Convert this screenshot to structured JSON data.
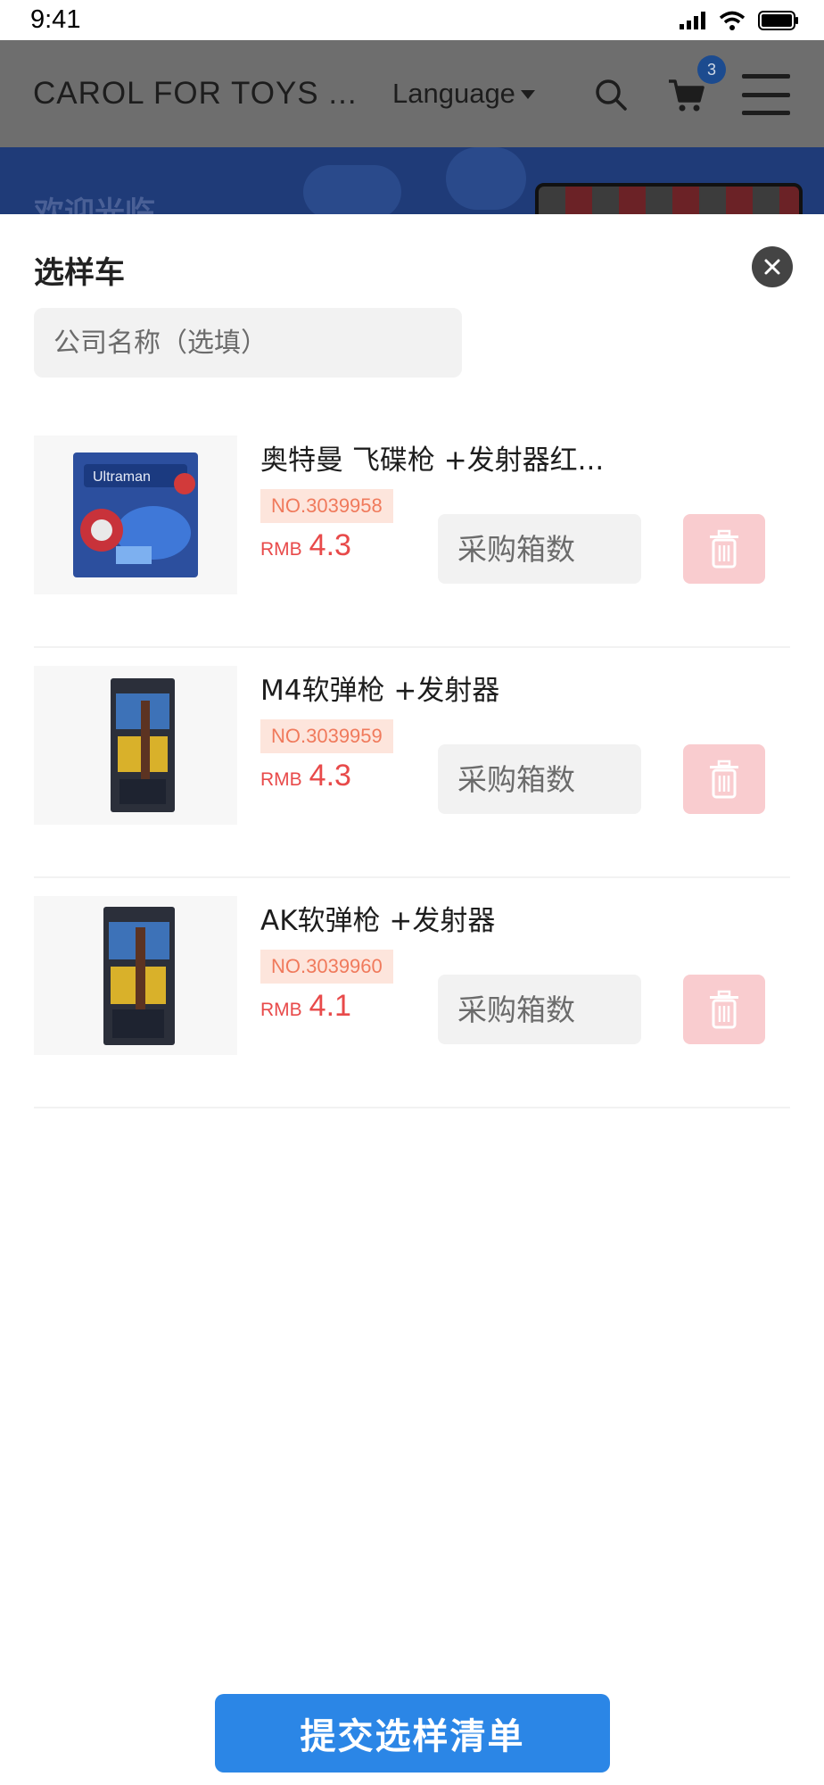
{
  "status_bar": {
    "time": "9:41"
  },
  "header": {
    "brand": "CAROL FOR TOYS ...",
    "language_label": "Language",
    "cart_count": "3"
  },
  "banner": {
    "text": "欢迎光临"
  },
  "sheet": {
    "title": "选样车",
    "company_placeholder": "公司名称（选填）",
    "qty_placeholder": "采购箱数",
    "submit_label": "提交选样清单",
    "items": [
      {
        "name": "奥特曼 飞碟枪 +发射器红...",
        "no": "NO.3039958",
        "currency": "RMB",
        "price": "4.3"
      },
      {
        "name": "M4软弹枪 +发射器",
        "no": "NO.3039959",
        "currency": "RMB",
        "price": "4.3"
      },
      {
        "name": "AK软弹枪 +发射器",
        "no": "NO.3039960",
        "currency": "RMB",
        "price": "4.1"
      }
    ]
  },
  "colors": {
    "header_bg": "#6e6e6e",
    "banner_bg": "#1f3b78",
    "price_red": "#e84a4a",
    "delete_bg": "#f9cccf",
    "submit_bg": "#2b86e6",
    "badge_bg": "#1c4b8f"
  },
  "icons": [
    "signal-icon",
    "wifi-icon",
    "battery-icon",
    "search-icon",
    "cart-icon",
    "menu-icon",
    "close-icon",
    "trash-icon"
  ]
}
